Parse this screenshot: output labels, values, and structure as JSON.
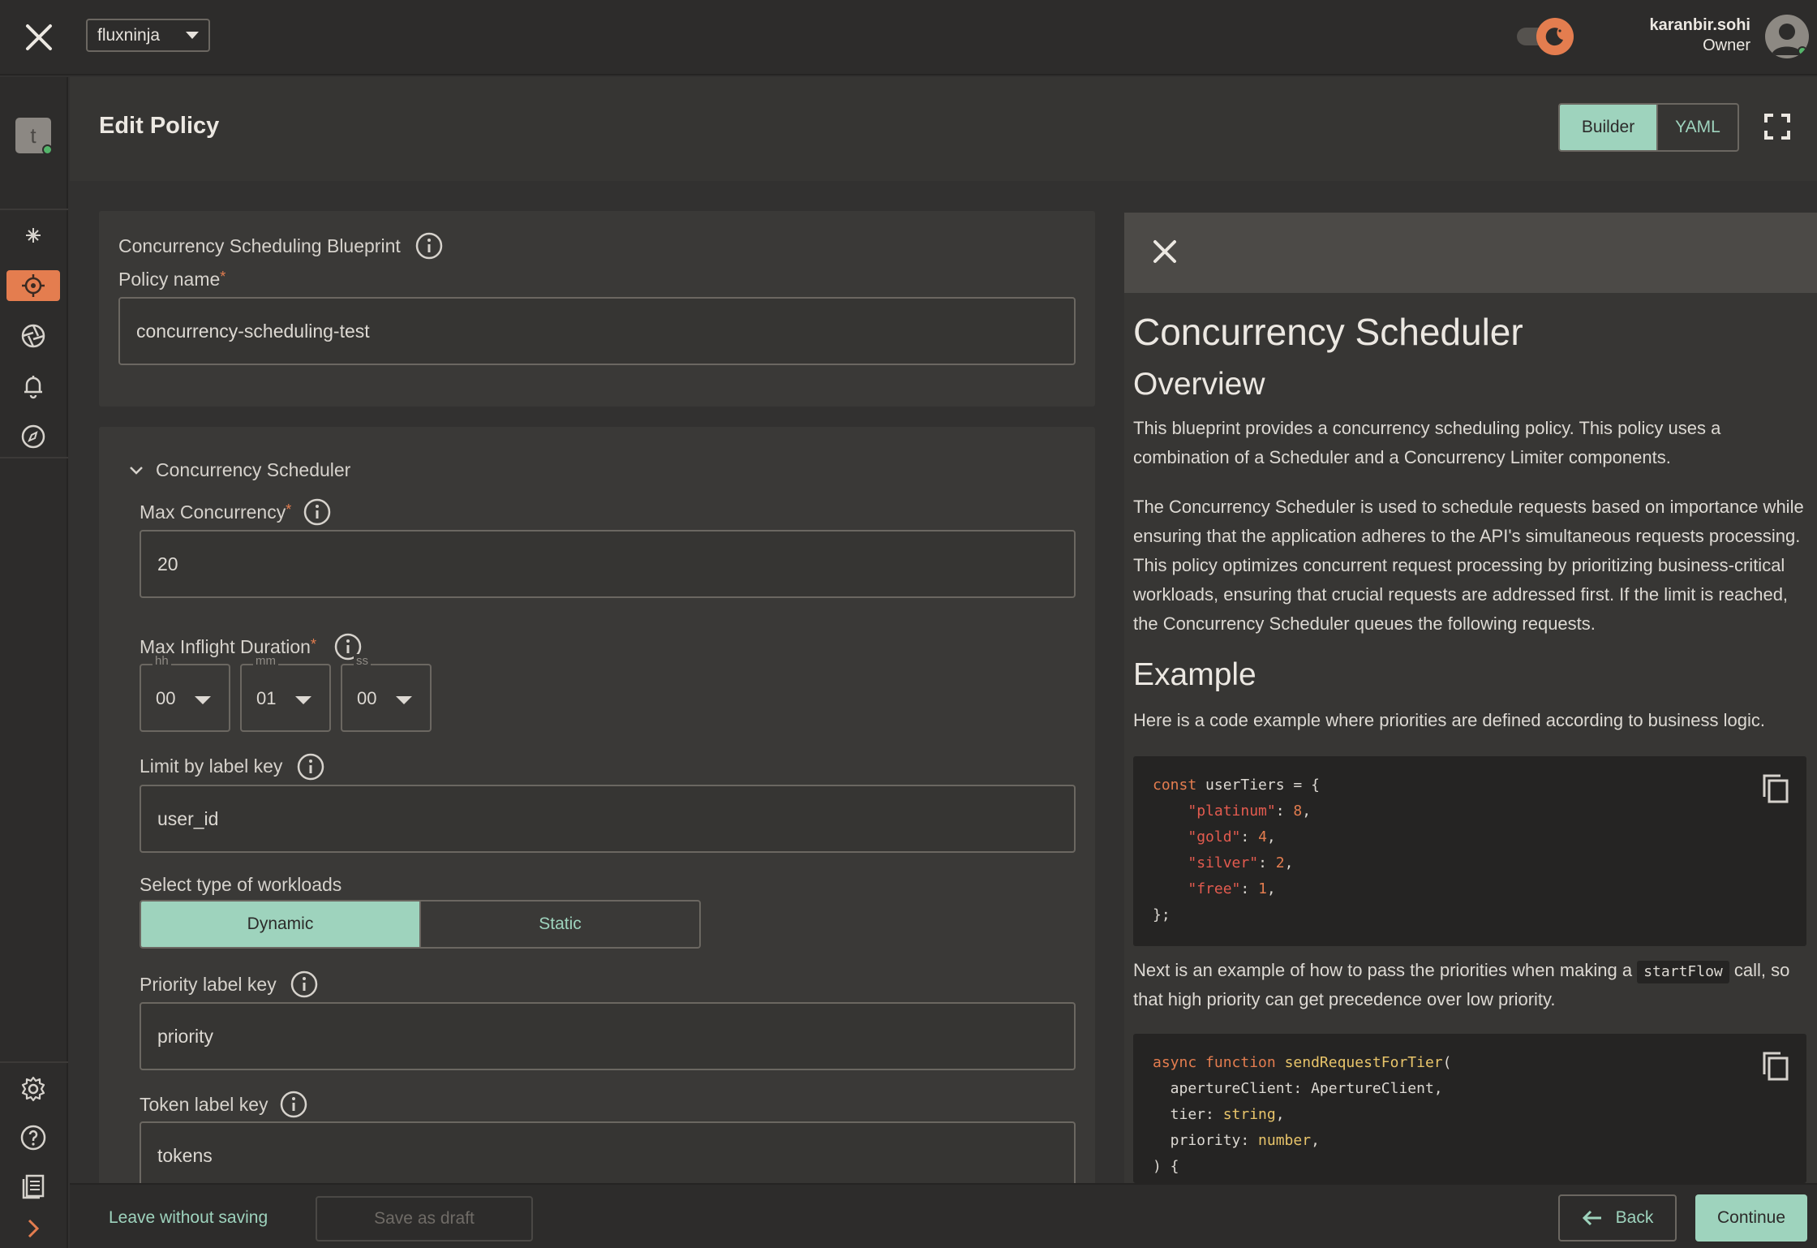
{
  "topbar": {
    "org": "fluxninja",
    "user_name": "karanbir.sohi",
    "user_role": "Owner"
  },
  "rail": {
    "workspace_initial": "t"
  },
  "header": {
    "title": "Edit Policy",
    "mode_builder": "Builder",
    "mode_yaml": "YAML",
    "active_mode": "Builder"
  },
  "form": {
    "blueprint_label": "Concurrency Scheduling Blueprint",
    "policy_name_label": "Policy name",
    "required_mark": "*",
    "policy_name_value": "concurrency-scheduling-test",
    "section_title": "Concurrency Scheduler",
    "max_concurrency_label": "Max Concurrency",
    "max_concurrency_value": "20",
    "max_inflight_label": "Max Inflight Duration",
    "duration": {
      "hh_label": "hh",
      "hh_value": "00",
      "mm_label": "mm",
      "mm_value": "01",
      "ss_label": "ss",
      "ss_value": "00"
    },
    "limit_label_key_label": "Limit by label key",
    "limit_label_key_value": "user_id",
    "workload_type_label": "Select type of workloads",
    "workload_dynamic": "Dynamic",
    "workload_static": "Static",
    "selected_workload": "Dynamic",
    "priority_label_key_label": "Priority label key",
    "priority_label_key_value": "priority",
    "token_label_key_label": "Token label key",
    "token_label_key_value": "tokens"
  },
  "docs": {
    "title": "Concurrency Scheduler",
    "overview_heading": "Overview",
    "overview_p1": "This blueprint provides a concurrency scheduling policy. This policy uses a combination of a Scheduler and a Concurrency Limiter components.",
    "overview_p2": "The Concurrency Scheduler is used to schedule requests based on importance while ensuring that the application adheres to the API's simultaneous requests processing. This policy optimizes concurrent request processing by prioritizing business-critical workloads, ensuring that crucial requests are addressed first. If the limit is reached, the Concurrency Scheduler queues the following requests.",
    "example_heading": "Example",
    "example_intro": "Here is a code example where priorities are defined according to business logic.",
    "next_intro_before": "Next is an example of how to pass the priorities when making a",
    "next_intro_code": "startFlow",
    "next_intro_after": "call, so that high priority can get precedence over low priority."
  },
  "footer": {
    "leave": "Leave without saving",
    "draft": "Save as draft",
    "back": "Back",
    "continue": "Continue"
  },
  "colors": {
    "accent": "#9ed3bd",
    "brand": "#e47d4f",
    "background": "#323130"
  },
  "icons": [
    "close-icon",
    "dropdown-caret-icon",
    "theme-toggle-icon",
    "avatar-icon",
    "info-icon",
    "chevron-down-icon",
    "copy-icon",
    "fullscreen-icon",
    "settings-icon",
    "help-icon",
    "docs-icon",
    "arrow-left-icon",
    "chevron-right-icon"
  ]
}
